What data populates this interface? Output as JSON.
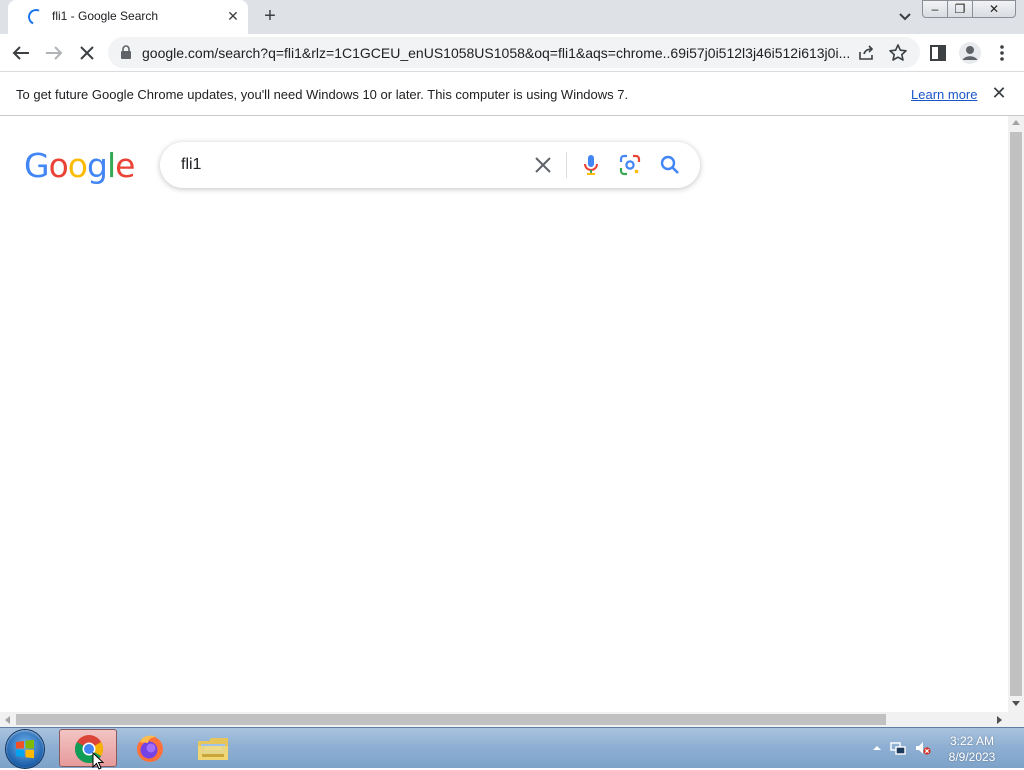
{
  "browser": {
    "tab": {
      "title": "fli1 - Google Search",
      "close_glyph": "✕"
    },
    "new_tab_glyph": "+",
    "window_controls": {
      "minimize": "–",
      "restore": "❐",
      "close": "✕"
    },
    "url": "google.com/search?q=fli1&rlz=1C1GCEU_enUS1058US1058&oq=fli1&aqs=chrome..69i57j0i512l3j46i512i613j0i..."
  },
  "infobar": {
    "message": "To get future Google Chrome updates, you'll need Windows 10 or later. This computer is using Windows 7.",
    "link": "Learn more",
    "close_glyph": "✕"
  },
  "google": {
    "logo_letters": [
      "G",
      "o",
      "o",
      "g",
      "l",
      "e"
    ],
    "logo_colors": [
      "#4285f4",
      "#ea4335",
      "#fbbc05",
      "#4285f4",
      "#34a853",
      "#ea4335"
    ],
    "query": "fli1"
  },
  "taskbar": {
    "time": "3:22 AM",
    "date": "8/9/2023",
    "apps": [
      "chrome",
      "firefox",
      "file-explorer"
    ]
  },
  "colors": {
    "accent": "#1a73e8",
    "link": "#1a56c8"
  }
}
